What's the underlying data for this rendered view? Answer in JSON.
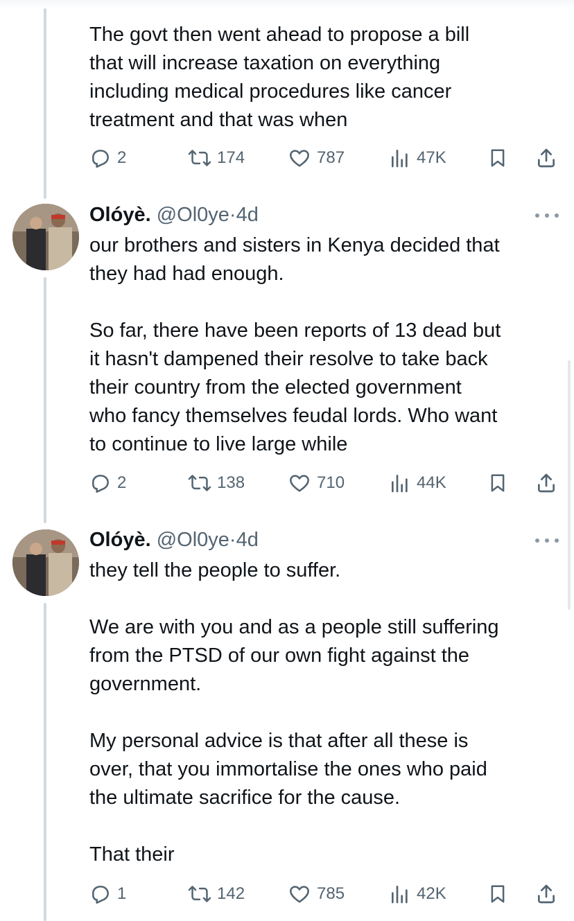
{
  "tweets": [
    {
      "text": "The govt then went ahead to propose a bill\nthat will increase taxation on everything\nincluding medical procedures like cancer\ntreatment and that was when",
      "replies": "2",
      "retweets": "174",
      "likes": "787",
      "views": "47K"
    },
    {
      "name": "Olóyè.",
      "handle": "@Ol0ye",
      "dot": "·",
      "time": "4d",
      "text": "our brothers and sisters in Kenya decided that\nthey had had enough.\n\nSo far, there have been reports of 13 dead but\nit hasn't dampened their resolve to take back\ntheir country from the elected government\nwho fancy themselves feudal lords. Who want\nto continue to live large while",
      "replies": "2",
      "retweets": "138",
      "likes": "710",
      "views": "44K"
    },
    {
      "name": "Olóyè.",
      "handle": "@Ol0ye",
      "dot": "·",
      "time": "4d",
      "text": "they tell the people to suffer.\n\nWe are with you and as a people still suffering\nfrom the PTSD of our own fight against the\ngovernment.\n\nMy personal advice is that after all these is\nover, that you immortalise the ones who paid\nthe ultimate sacrifice for the cause.\n\nThat their",
      "replies": "1",
      "retweets": "142",
      "likes": "785",
      "views": "42K"
    }
  ],
  "icons": {
    "reply": "reply-icon",
    "retweet": "retweet-icon",
    "like": "heart-icon",
    "views": "views-icon",
    "bookmark": "bookmark-icon",
    "share": "share-icon",
    "more": "more-icon"
  },
  "colors": {
    "text": "#0f1419",
    "secondary": "#536471",
    "thread_line": "#cfd9de"
  }
}
